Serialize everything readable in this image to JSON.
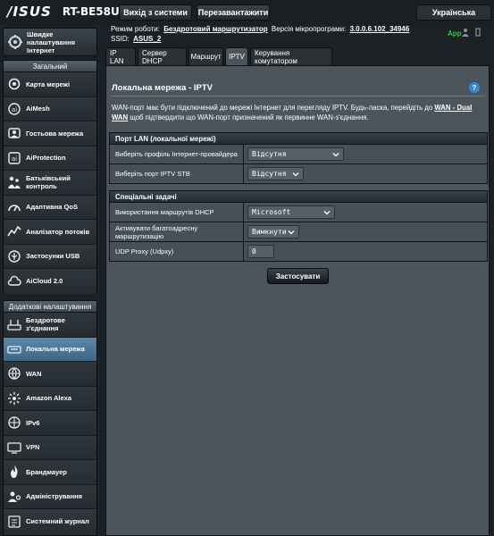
{
  "header": {
    "brand": "/ISUS",
    "model": "RT-BE58U",
    "logout_label": "Вихід з системи",
    "reboot_label": "Перезавантажити",
    "language": "Українська"
  },
  "info": {
    "mode_label": "Режим роботи:",
    "mode_value": "Бездротовий маршрутизатор",
    "firmware_label": "Версія мікропрограми:",
    "firmware_value": "3.0.0.6.102_34946",
    "ssid_label": "SSID:",
    "ssid_value": "ASUS_2",
    "app_label": "App"
  },
  "sidebar": {
    "quick_setup": "Швидке налаштування Інтернет",
    "general_header": "Загальний",
    "general_items": [
      {
        "label": "Карта мережі",
        "icon": "network-map-icon"
      },
      {
        "label": "AiMesh",
        "icon": "aimesh-icon"
      },
      {
        "label": "Гостьова мережа",
        "icon": "guest-network-icon"
      },
      {
        "label": "AiProtection",
        "icon": "aiprotection-icon"
      },
      {
        "label": "Батьківський контроль",
        "icon": "parental-control-icon"
      },
      {
        "label": "Адаптивна QoS",
        "icon": "qos-icon"
      },
      {
        "label": "Аналізатор потоків",
        "icon": "traffic-analyzer-icon"
      },
      {
        "label": "Застосунки USB",
        "icon": "usb-icon"
      },
      {
        "label": "AiCloud 2.0",
        "icon": "aicloud-icon"
      }
    ],
    "advanced_header": "Додаткові налаштування",
    "advanced_items": [
      {
        "label": "Бездротове з'єднання",
        "icon": "wireless-icon"
      },
      {
        "label": "Локальна мережа",
        "icon": "lan-icon"
      },
      {
        "label": "WAN",
        "icon": "wan-icon"
      },
      {
        "label": "Amazon Alexa",
        "icon": "alexa-icon"
      },
      {
        "label": "IPv6",
        "icon": "ipv6-icon"
      },
      {
        "label": "VPN",
        "icon": "vpn-icon"
      },
      {
        "label": "Брандмауер",
        "icon": "firewall-icon"
      },
      {
        "label": "Адміністрування",
        "icon": "administration-icon"
      },
      {
        "label": "Системний журнал",
        "icon": "system-log-icon"
      }
    ]
  },
  "tabs": [
    "IP LAN",
    "Сервер DHCP",
    "Маршрут",
    "IPTV",
    "Керування комутатором"
  ],
  "main": {
    "title": "Локальна мережа - IPTV",
    "description_pre": "WAN-порт має бути підключений до мережі Інтернет для перегляду IPTV. Будь-ласка, перейдіть до ",
    "description_link": "WAN - Dual WAN",
    "description_post": " щоб підтвердити що WAN-порт призначений як первинне WAN-з'єднання.",
    "section1_title": "Порт LAN (локальної мережі)",
    "section1_rows": [
      {
        "label": "Виберіть профіль Інтернет-провайдера",
        "value": "Відсутня"
      },
      {
        "label": "Виберіть порт IPTV STB",
        "value": "Відсутня"
      }
    ],
    "section2_title": "Спеціальні задачі",
    "section2_rows": [
      {
        "label": "Використання маршрутів DHCP",
        "value": "Microsoft"
      },
      {
        "label": "Активувати багатоадресну маршрутизацію",
        "value": "Вимкнути"
      },
      {
        "label": "UDP Proxy (Udpxy)",
        "value": "0"
      }
    ],
    "apply_label": "Застосувати"
  },
  "colors": {
    "background": "#1c2125",
    "panel": "#4c555c",
    "active_menu": "#4f7899",
    "app_green": "#35c34a",
    "help_blue": "#2f8ad8"
  }
}
